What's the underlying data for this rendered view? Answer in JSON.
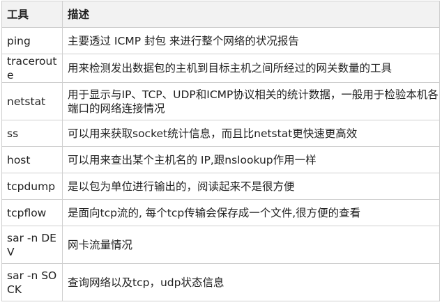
{
  "table": {
    "headers": [
      "工具",
      "描述"
    ],
    "rows": [
      {
        "tool": "ping",
        "desc": "主要透过 ICMP 封包 来进行整个网络的状况报告"
      },
      {
        "tool": "traceroute",
        "desc": "用来检测发出数据包的主机到目标主机之间所经过的网关数量的工具"
      },
      {
        "tool": "netstat",
        "desc": "用于显示与IP、TCP、UDP和ICMP协议相关的统计数据，一般用于检验本机各端口的网络连接情况"
      },
      {
        "tool": "ss",
        "desc": "可以用来获取socket统计信息，而且比netstat更快速更高效"
      },
      {
        "tool": "host",
        "desc": "可以用来查出某个主机名的 IP,跟nslookup作用一样"
      },
      {
        "tool": "tcpdump",
        "desc": "是以包为单位进行输出的，阅读起来不是很方便"
      },
      {
        "tool": "tcpflow",
        "desc": "是面向tcp流的, 每个tcp传输会保存成一个文件,很方便的查看"
      },
      {
        "tool": "sar -n DEV",
        "desc": "网卡流量情况"
      },
      {
        "tool": "sar -n SOCK",
        "desc": "查询网络以及tcp，udp状态信息"
      }
    ]
  }
}
